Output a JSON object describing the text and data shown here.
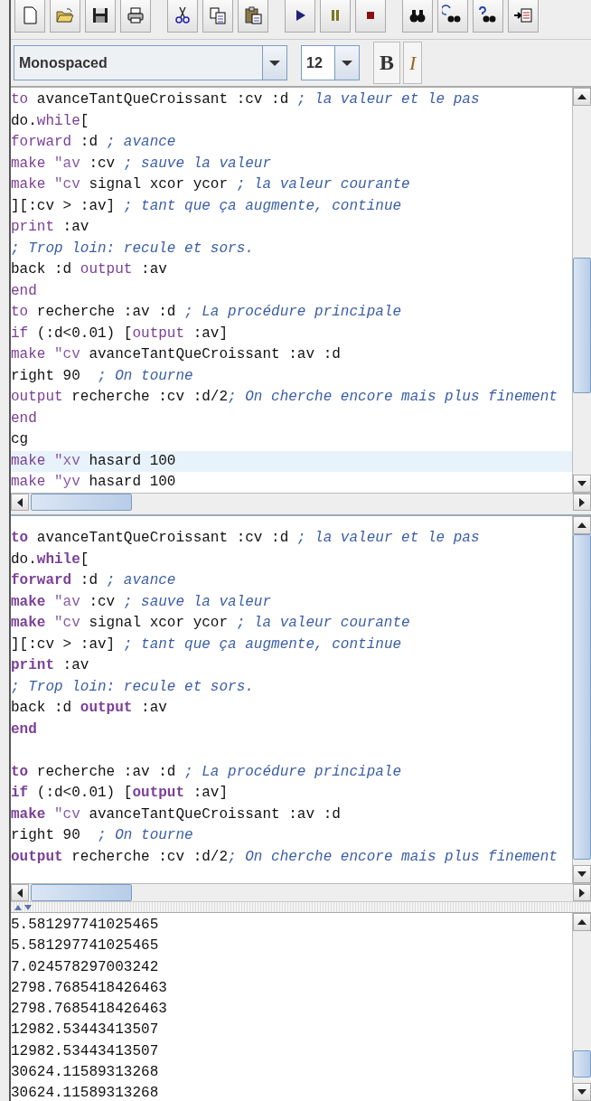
{
  "font_bar": {
    "font_family": "Monospaced",
    "font_size": "12",
    "bold_label": "B",
    "italic_label": "I"
  },
  "editor": {
    "bold_keywords": false,
    "lines": [
      {
        "highlighted": false,
        "tokens": [
          {
            "kind": "keyword",
            "text": "to"
          },
          {
            "kind": "plain",
            "text": " avanceTantQueCroissant :cv :d "
          },
          {
            "kind": "comment",
            "text": "; la valeur et le pas"
          }
        ]
      },
      {
        "highlighted": false,
        "tokens": [
          {
            "kind": "plain",
            "text": "do."
          },
          {
            "kind": "keyword",
            "text": "while"
          },
          {
            "kind": "plain",
            "text": "["
          }
        ]
      },
      {
        "highlighted": false,
        "tokens": [
          {
            "kind": "keyword",
            "text": "forward"
          },
          {
            "kind": "plain",
            "text": " :d "
          },
          {
            "kind": "comment",
            "text": "; avance"
          }
        ]
      },
      {
        "highlighted": false,
        "tokens": [
          {
            "kind": "keyword",
            "text": "make"
          },
          {
            "kind": "word",
            "text": " \"av"
          },
          {
            "kind": "plain",
            "text": " :cv "
          },
          {
            "kind": "comment",
            "text": "; sauve la valeur"
          }
        ]
      },
      {
        "highlighted": false,
        "tokens": [
          {
            "kind": "keyword",
            "text": "make"
          },
          {
            "kind": "word",
            "text": " \"cv"
          },
          {
            "kind": "plain",
            "text": " signal xcor ycor "
          },
          {
            "kind": "comment",
            "text": "; la valeur courante"
          }
        ]
      },
      {
        "highlighted": false,
        "tokens": [
          {
            "kind": "plain",
            "text": "][:cv > :av] "
          },
          {
            "kind": "comment",
            "text": "; tant que ça augmente, continue"
          }
        ]
      },
      {
        "highlighted": false,
        "tokens": [
          {
            "kind": "keyword",
            "text": "print"
          },
          {
            "kind": "plain",
            "text": " :av"
          }
        ]
      },
      {
        "highlighted": false,
        "tokens": [
          {
            "kind": "comment",
            "text": "; Trop loin: recule et sors."
          }
        ]
      },
      {
        "highlighted": false,
        "tokens": [
          {
            "kind": "plain",
            "text": "back :d "
          },
          {
            "kind": "keyword",
            "text": "output"
          },
          {
            "kind": "plain",
            "text": " :av"
          }
        ]
      },
      {
        "highlighted": false,
        "tokens": [
          {
            "kind": "keyword",
            "text": "end"
          }
        ]
      },
      {
        "highlighted": false,
        "tokens": [
          {
            "kind": "keyword",
            "text": "to"
          },
          {
            "kind": "plain",
            "text": " recherche :av :d "
          },
          {
            "kind": "comment",
            "text": "; La procédure principale"
          }
        ]
      },
      {
        "highlighted": false,
        "tokens": [
          {
            "kind": "keyword",
            "text": "if"
          },
          {
            "kind": "plain",
            "text": " (:d<0.01) ["
          },
          {
            "kind": "keyword",
            "text": "output"
          },
          {
            "kind": "plain",
            "text": " :av]"
          }
        ]
      },
      {
        "highlighted": false,
        "tokens": [
          {
            "kind": "keyword",
            "text": "make"
          },
          {
            "kind": "word",
            "text": " \"cv"
          },
          {
            "kind": "plain",
            "text": " avanceTantQueCroissant :av :d"
          }
        ]
      },
      {
        "highlighted": false,
        "tokens": [
          {
            "kind": "plain",
            "text": "right 90  "
          },
          {
            "kind": "comment",
            "text": "; On tourne"
          }
        ]
      },
      {
        "highlighted": false,
        "tokens": [
          {
            "kind": "keyword",
            "text": "output"
          },
          {
            "kind": "plain",
            "text": " recherche :cv :d/2"
          },
          {
            "kind": "comment",
            "text": "; On cherche encore mais plus finement"
          }
        ]
      },
      {
        "highlighted": false,
        "tokens": [
          {
            "kind": "keyword",
            "text": "end"
          }
        ]
      },
      {
        "highlighted": false,
        "tokens": [
          {
            "kind": "plain",
            "text": "cg"
          }
        ]
      },
      {
        "highlighted": true,
        "tokens": [
          {
            "kind": "keyword",
            "text": "make"
          },
          {
            "kind": "word",
            "text": " \"xv"
          },
          {
            "kind": "plain",
            "text": " hasard 100"
          }
        ]
      },
      {
        "highlighted": false,
        "tokens": [
          {
            "kind": "keyword",
            "text": "make"
          },
          {
            "kind": "word",
            "text": " \"yv"
          },
          {
            "kind": "plain",
            "text": " hasard 100"
          }
        ]
      }
    ]
  },
  "preview": {
    "bold_keywords": true,
    "blocks": [
      {
        "lines": [
          {
            "tokens": [
              {
                "kind": "keyword",
                "text": "to"
              },
              {
                "kind": "plain",
                "text": " avanceTantQueCroissant :cv :d "
              },
              {
                "kind": "comment",
                "text": "; la valeur et le pas"
              }
            ]
          },
          {
            "tokens": [
              {
                "kind": "plain",
                "text": "do."
              },
              {
                "kind": "keyword",
                "text": "while"
              },
              {
                "kind": "plain",
                "text": "["
              }
            ]
          },
          {
            "tokens": [
              {
                "kind": "keyword",
                "text": "forward"
              },
              {
                "kind": "plain",
                "text": " :d "
              },
              {
                "kind": "comment",
                "text": "; avance"
              }
            ]
          },
          {
            "tokens": [
              {
                "kind": "keyword",
                "text": "make"
              },
              {
                "kind": "word",
                "text": " \"av"
              },
              {
                "kind": "plain",
                "text": " :cv "
              },
              {
                "kind": "comment",
                "text": "; sauve la valeur"
              }
            ]
          },
          {
            "tokens": [
              {
                "kind": "keyword",
                "text": "make"
              },
              {
                "kind": "word",
                "text": " \"cv"
              },
              {
                "kind": "plain",
                "text": " signal xcor ycor "
              },
              {
                "kind": "comment",
                "text": "; la valeur courante"
              }
            ]
          },
          {
            "tokens": [
              {
                "kind": "plain",
                "text": "][:cv > :av] "
              },
              {
                "kind": "comment",
                "text": "; tant que ça augmente, continue"
              }
            ]
          },
          {
            "tokens": [
              {
                "kind": "keyword",
                "text": "print"
              },
              {
                "kind": "plain",
                "text": " :av"
              }
            ]
          },
          {
            "tokens": [
              {
                "kind": "comment",
                "text": "; Trop loin: recule et sors."
              }
            ]
          },
          {
            "tokens": [
              {
                "kind": "plain",
                "text": "back :d "
              },
              {
                "kind": "keyword",
                "text": "output"
              },
              {
                "kind": "plain",
                "text": " :av"
              }
            ]
          },
          {
            "tokens": [
              {
                "kind": "keyword",
                "text": "end"
              }
            ]
          }
        ]
      },
      {
        "lines": [
          {
            "tokens": [
              {
                "kind": "keyword",
                "text": "to"
              },
              {
                "kind": "plain",
                "text": " recherche :av :d "
              },
              {
                "kind": "comment",
                "text": "; La procédure principale"
              }
            ]
          },
          {
            "tokens": [
              {
                "kind": "keyword",
                "text": "if"
              },
              {
                "kind": "plain",
                "text": " (:d<0.01) ["
              },
              {
                "kind": "keyword",
                "text": "output"
              },
              {
                "kind": "plain",
                "text": " :av]"
              }
            ]
          },
          {
            "tokens": [
              {
                "kind": "keyword",
                "text": "make"
              },
              {
                "kind": "word",
                "text": " \"cv"
              },
              {
                "kind": "plain",
                "text": " avanceTantQueCroissant :av :d"
              }
            ]
          },
          {
            "tokens": [
              {
                "kind": "plain",
                "text": "right 90  "
              },
              {
                "kind": "comment",
                "text": "; On tourne"
              }
            ]
          },
          {
            "tokens": [
              {
                "kind": "keyword",
                "text": "output"
              },
              {
                "kind": "plain",
                "text": " recherche :cv :d/2"
              },
              {
                "kind": "comment",
                "text": "; On cherche encore mais plus finement"
              }
            ]
          }
        ]
      }
    ]
  },
  "output": {
    "lines": [
      "5.581297741025465",
      "5.581297741025465",
      "7.024578297003242",
      "2798.7685418426463",
      "2798.7685418426463",
      "12982.53443413507",
      "12982.53443413507",
      "30624.11589313268",
      "30624.11589313268"
    ]
  }
}
